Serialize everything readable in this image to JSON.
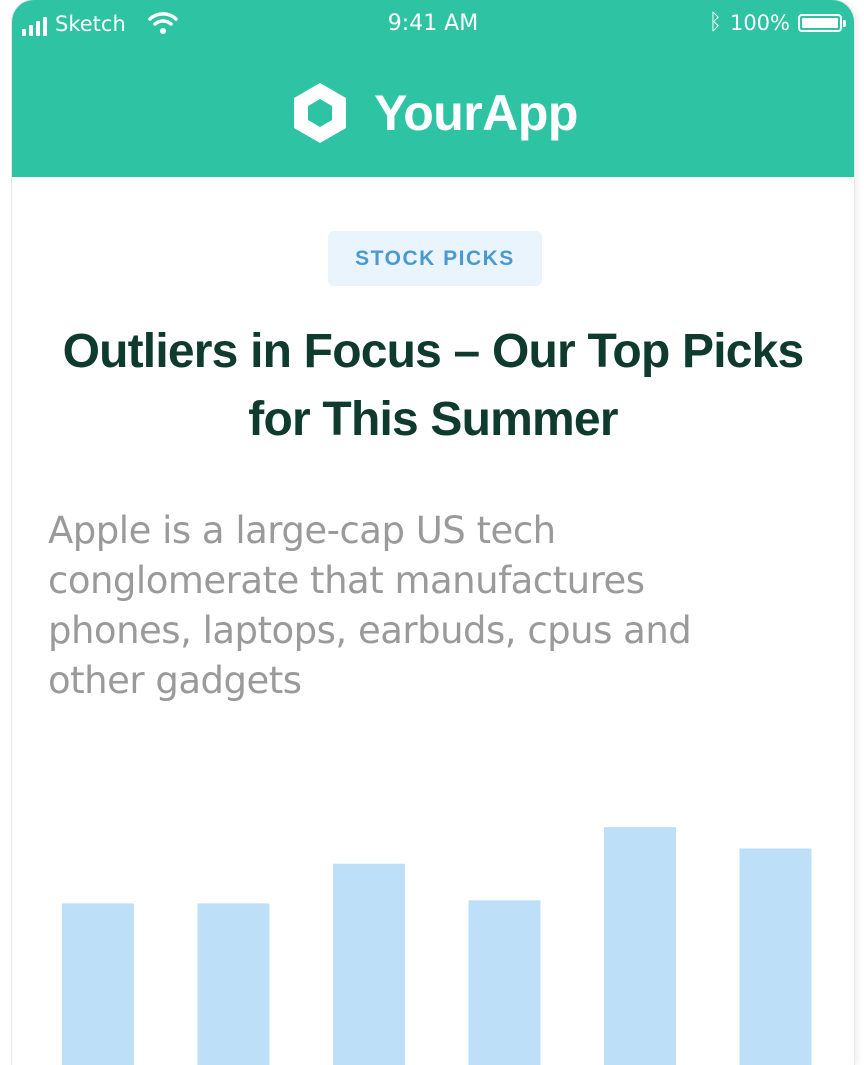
{
  "status_bar": {
    "carrier": "Sketch",
    "time": "9:41 AM",
    "battery": "100%"
  },
  "header": {
    "app_name": "YourApp",
    "logo_icon": "hexagon-logo-icon",
    "background": "#2ec4a3"
  },
  "article": {
    "tag": "STOCK PICKS",
    "title": "Outliers in Focus – Our Top Picks for This Summer",
    "description": "Apple is a large-cap US tech conglomerate that manufactures phones, laptops, earbuds, cpus and other gadgets"
  },
  "chart_data": {
    "type": "bar",
    "categories": [
      "",
      "",
      "",
      "",
      "",
      ""
    ],
    "values": [
      53,
      53,
      66,
      54,
      78,
      71
    ],
    "ylim": [
      0,
      100
    ],
    "color": "#bde0f8",
    "grid": false
  }
}
